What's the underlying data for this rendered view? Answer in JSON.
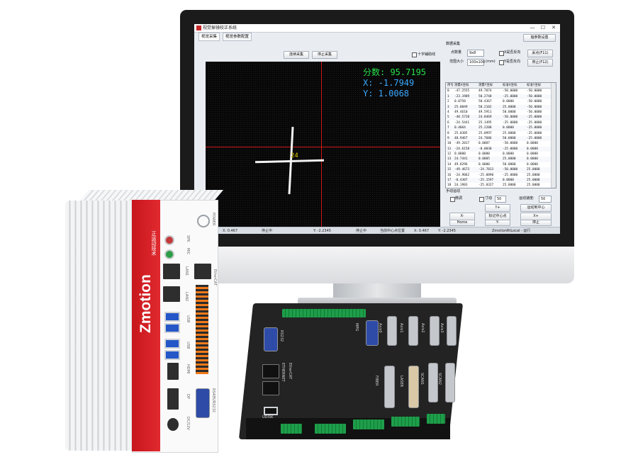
{
  "app": {
    "title": "视觉振镜校正系统",
    "tabs": [
      "视觉采集",
      "视觉参数配置"
    ],
    "top_right_button": "轴参数设置",
    "buttons": {
      "continuous_capture": "连续采集",
      "stop_capture": "停止采集"
    },
    "crosshair_checkbox": "十字辅助线",
    "overlay": {
      "score": "分数: 95.7195",
      "x": "X: -1.7949",
      "y": "Y: 1.0068"
    },
    "mark_number": "24",
    "data_panel": {
      "title": "数据采集",
      "point_count_label": "点数量",
      "point_count_value": "9x8",
      "range_label": "范围大小",
      "range_value": "100x100",
      "range_unit": "(mm)",
      "x_forward_label": "X是否反向",
      "y_forward_label": "Y是否反向",
      "sample_button": "采点(F11)",
      "stop_button": "停止(F12)"
    },
    "table": {
      "headers": [
        "序号",
        "测量X坐标",
        "测量Y坐标",
        "标准X坐标",
        "标准Y坐标"
      ],
      "rows": [
        [
          "0",
          "-47.2555",
          "49.7074",
          "-50.0000",
          "-50.0000"
        ],
        [
          "1",
          "-23.1989",
          "50.2740",
          "-25.0000",
          "-50.0000"
        ],
        [
          "2",
          "0.0750",
          "50.4367",
          "0.0000",
          "-50.0000"
        ],
        [
          "3",
          "25.0049",
          "50.2102",
          "25.0000",
          "-50.0000"
        ],
        [
          "4",
          "49.4610",
          "49.5911",
          "50.0000",
          "-50.0000"
        ],
        [
          "5",
          "-48.5720",
          "24.8469",
          "-50.0000",
          "-25.0000"
        ],
        [
          "6",
          "-24.5441",
          "25.1495",
          "-25.0000",
          "-25.0000"
        ],
        [
          "7",
          "0.4064",
          "25.2208",
          "0.0000",
          "-25.0000"
        ],
        [
          "8",
          "25.0305",
          "25.0997",
          "25.0000",
          "-25.0000"
        ],
        [
          "9",
          "48.9467",
          "24.7606",
          "50.0000",
          "-25.0000"
        ],
        [
          "10",
          "-49.2017",
          "0.0007",
          "-50.0000",
          "0.0000"
        ],
        [
          "11",
          "-24.6158",
          "-0.0030",
          "-25.0000",
          "0.0000"
        ],
        [
          "12",
          "0.0000",
          "0.0000",
          "0.0000",
          "0.0000"
        ],
        [
          "13",
          "24.7441",
          "0.0005",
          "25.0000",
          "0.0000"
        ],
        [
          "14",
          "49.8296",
          "0.0000",
          "50.0000",
          "0.0000"
        ],
        [
          "15",
          "-49.4673",
          "-24.7813",
          "-50.0000",
          "25.0000"
        ],
        [
          "16",
          "-24.9062",
          "-25.0890",
          "-25.0000",
          "25.0000"
        ],
        [
          "17",
          "-0.4307",
          "-25.1597",
          "0.0000",
          "25.0000"
        ],
        [
          "18",
          "24.1983",
          "-25.0327",
          "25.0000",
          "25.0000"
        ]
      ]
    },
    "manual": {
      "title": "手动运动",
      "fine_label": "微调",
      "inch_label": "寸动",
      "inch_value": "50",
      "speed_label": "运动速度:",
      "speed_value": "50",
      "move_center": "运动到中心",
      "y_plus": "Y+",
      "x_minus": "X-",
      "mark_center": "标记中心点",
      "x_plus": "X+",
      "home": "Home",
      "y_minus": "Y-",
      "stop": "停止"
    },
    "status": {
      "x": "X: 0.467",
      "x_state": "停止中",
      "y": "Y: -2.2345",
      "y_state": "停止中",
      "center_label": "当前中心点位置",
      "center_x": "X: 0.467",
      "center_y": "Y: -2.2345",
      "connection": "ZmotionRtLocal - 运行"
    }
  },
  "ipc": {
    "brand": "Zmotion",
    "brand_sub": "正运动技术",
    "labels": [
      "POWER",
      "LAN1",
      "LAN2",
      "EtherCAT",
      "USB",
      "USB",
      "HDMI",
      "DP",
      "RS485/RS232",
      "DC/12V",
      "SPK",
      "MIC"
    ]
  },
  "controller": {
    "labels": [
      "RS232",
      "ETHERNET",
      "EtherCAT",
      "UDISK",
      "MPG",
      "FIBER",
      "LASER",
      "SCAN1",
      "SCAN2",
      "Axis0",
      "Axis1",
      "Axis2",
      "Axis3"
    ]
  }
}
